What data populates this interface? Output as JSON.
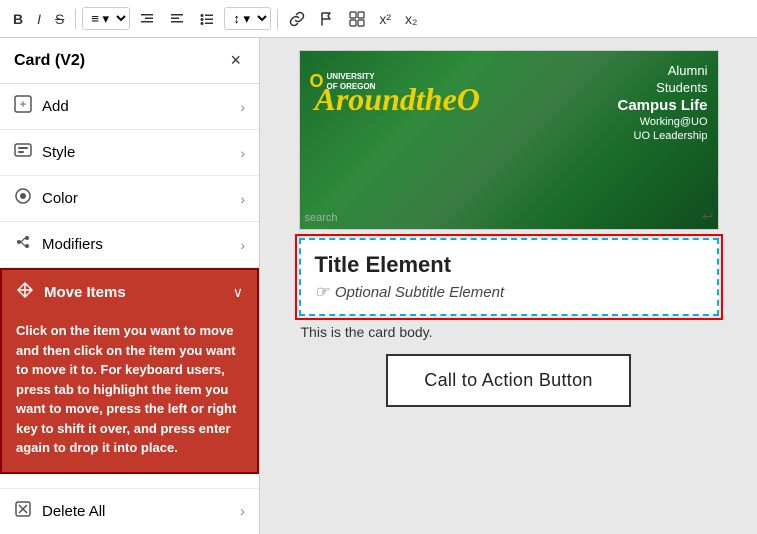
{
  "toolbar": {
    "bold_label": "B",
    "italic_label": "I",
    "strikethrough_label": "S",
    "align_label": "≡",
    "indent_label": "≡",
    "list_label": "≡",
    "line_height_label": "≡",
    "link_label": "🔗",
    "flag_label": "⚑",
    "special_label": "⊞",
    "superscript_label": "x²",
    "subscript_label": "x₂"
  },
  "sidebar": {
    "title": "Card (V2)",
    "close_label": "×",
    "items": [
      {
        "id": "add",
        "icon": "➕",
        "label": "Add"
      },
      {
        "id": "style",
        "icon": "🖥",
        "label": "Style"
      },
      {
        "id": "color",
        "icon": "🎨",
        "label": "Color"
      },
      {
        "id": "modifiers",
        "icon": "",
        "label": "Modifiers"
      }
    ],
    "move_items": {
      "label": "Move Items",
      "icon": "⊕",
      "description": "Click on the item you want to move and then click on the item you want to move it to. For keyboard users, press tab to highlight the item you want to move, press the left or right key to shift it over, and press enter again to drop it into place."
    },
    "delete_all": {
      "icon": "🗑",
      "label": "Delete All"
    }
  },
  "content": {
    "card_image": {
      "logo_text": "🅾 UNIVERSITY\nOF OREGON",
      "brand_text": "AroundtheO",
      "nav_items": [
        "Alumni",
        "Students",
        "Campus Life",
        "Working@UO",
        "UO Leadership"
      ]
    },
    "title_element": {
      "title": "Title Element",
      "subtitle": "Optional Subtitle Element"
    },
    "body_text": "This is the card body.",
    "cta_label": "Call to Action Button"
  }
}
